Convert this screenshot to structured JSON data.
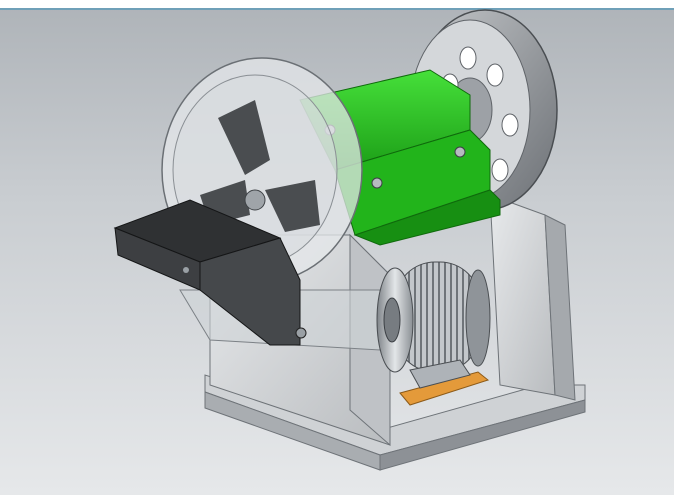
{
  "viewport": {
    "title": "",
    "background_top": "#aeb3b8",
    "background_bottom": "#e6e8ea",
    "accent_border": "#6fa0b8"
  },
  "model": {
    "parts": [
      {
        "name": "frame",
        "color": "#d7d9db"
      },
      {
        "name": "green-housing",
        "color": "#27c41f"
      },
      {
        "name": "flywheel-pulley",
        "color": "#9fa3a7"
      },
      {
        "name": "transparent-guard",
        "color": "#e3e6ea"
      },
      {
        "name": "feed-hopper",
        "color": "#3b3d3f"
      },
      {
        "name": "electric-motor",
        "color": "#b9bec3"
      },
      {
        "name": "motor-mount",
        "color": "#e49a3a"
      }
    ]
  }
}
